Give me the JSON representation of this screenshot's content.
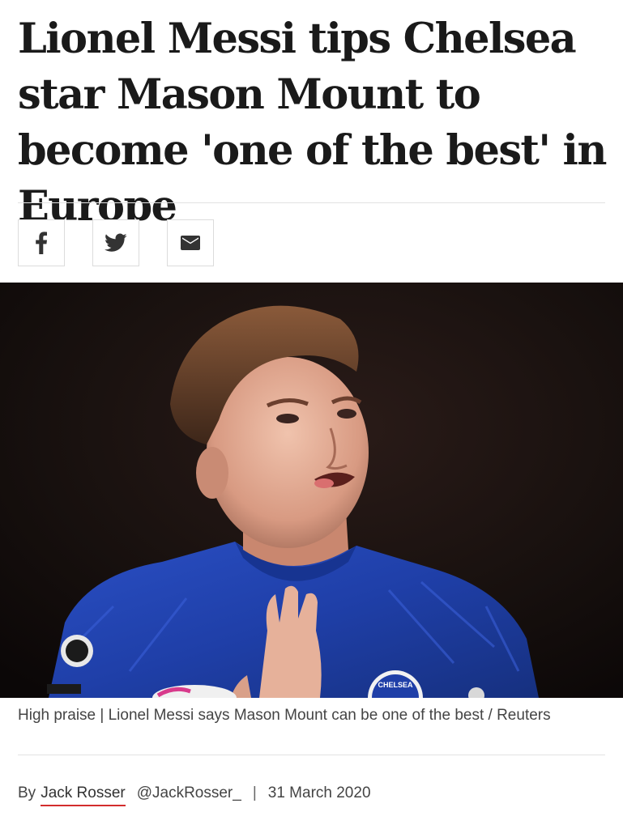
{
  "article": {
    "headline": "Lionel Messi tips Chelsea star Mason Mount to become 'one of the best' in Europe",
    "caption": "High praise | Lionel Messi says Mason Mount can be one of the best / Reuters",
    "byline": {
      "prefix": "By",
      "author": "Jack Rosser",
      "handle": "@JackRosser_",
      "separator": "|",
      "date": "31 March 2020"
    }
  },
  "share": {
    "buttons": [
      {
        "icon": "facebook-icon"
      },
      {
        "icon": "twitter-icon"
      },
      {
        "icon": "email-icon"
      }
    ]
  },
  "hero": {
    "crest_text": "CHELSEA"
  },
  "colors": {
    "author_underline": "#d32d2d",
    "kit_blue": "#1f3fa8"
  }
}
